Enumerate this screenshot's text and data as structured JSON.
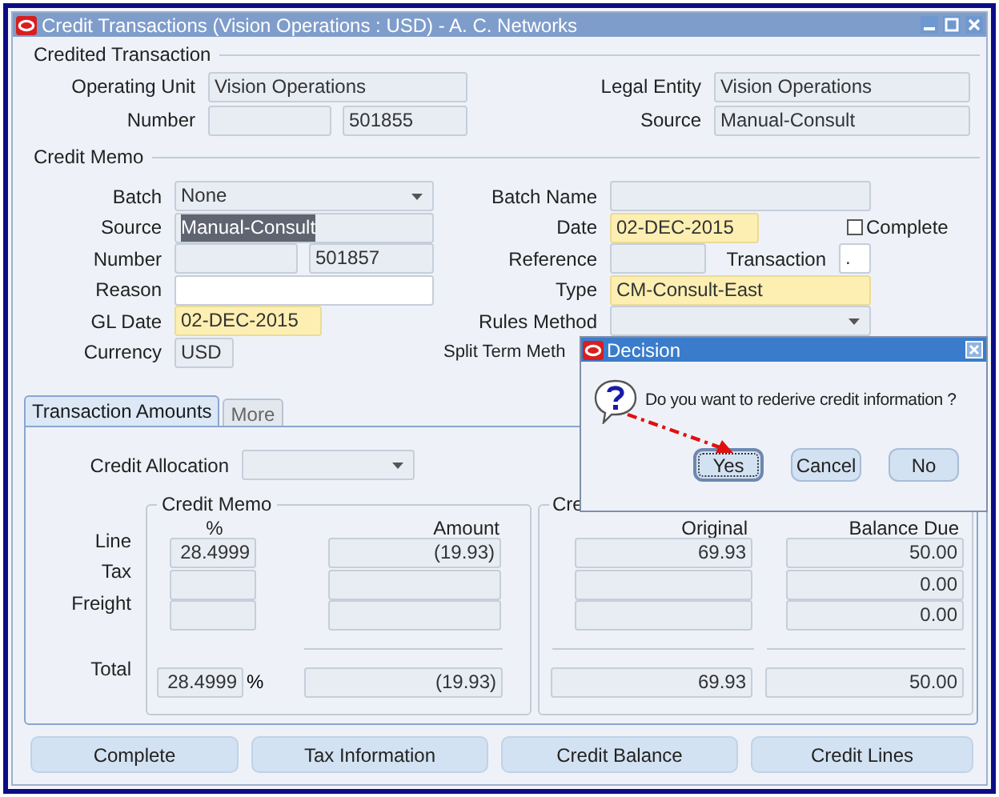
{
  "window": {
    "title": "Credit Transactions (Vision Operations : USD) - A. C. Networks"
  },
  "credited_transaction": {
    "title": "Credited Transaction",
    "left": [
      {
        "label": "Operating Unit",
        "value": "Vision Operations",
        "kind": "readonly"
      },
      {
        "label": "Number",
        "value": "501855",
        "kind": "split"
      }
    ],
    "right": [
      {
        "label": "Legal Entity",
        "value": "Vision Operations",
        "kind": "readonly"
      },
      {
        "label": "Source",
        "value": "Manual-Consult",
        "kind": "readonly"
      }
    ]
  },
  "credit_memo": {
    "title": "Credit Memo",
    "left": [
      {
        "label": "Batch",
        "value": "None",
        "kind": "dropdown"
      },
      {
        "label": "Source",
        "value": "Manual-Consult",
        "kind": "highlighted"
      },
      {
        "label": "Number",
        "value": "501857",
        "kind": "split"
      },
      {
        "label": "Reason",
        "kind": "editable"
      },
      {
        "label": "GL Date",
        "value": "02-DEC-2015",
        "kind": "required"
      },
      {
        "label": "Currency",
        "value": "USD",
        "kind": "readonly"
      }
    ],
    "right": [
      {
        "label": "Batch Name",
        "kind": "readonly"
      },
      {
        "label": "Date",
        "value": "02-DEC-2015",
        "kind": "required"
      },
      {
        "label": "Reference",
        "kind": "readonly"
      },
      {
        "label": "Type",
        "value": "CM-Consult-East",
        "kind": "required"
      },
      {
        "label": "Rules Method",
        "kind": "dropdown"
      },
      {
        "label": "Split Term Meth",
        "kind": "hidden"
      }
    ],
    "complete_checkbox": {
      "label": "Complete",
      "checked": false
    },
    "transaction_field": {
      "label": "Transaction",
      "value": ".",
      "kind": "editable"
    }
  },
  "tabs": [
    {
      "label": "Transaction Amounts",
      "selected": true
    },
    {
      "label": "More",
      "selected": false
    }
  ],
  "credit_allocation": {
    "label": "Credit Allocation",
    "kind": "dropdown"
  },
  "amounts": {
    "group_1": {
      "title": "Credit Memo",
      "columns": [
        "%",
        "Amount"
      ]
    },
    "group_2": {
      "title": "Cre",
      "columns": [
        "Original",
        "Balance Due"
      ]
    },
    "rows": [
      {
        "label": "Line",
        "percent": "28.4999",
        "amount": "(19.93)",
        "original": "69.93",
        "balance_due": "50.00"
      },
      {
        "label": "Tax",
        "balance_due": "0.00"
      },
      {
        "label": "Freight",
        "balance_due": "0.00"
      }
    ],
    "total": {
      "label": "Total",
      "percent": "28.4999",
      "unit": "%",
      "amount": "(19.93)",
      "original": "69.93",
      "balance_due": "50.00"
    }
  },
  "buttons": [
    "Complete",
    "Tax Information",
    "Credit Balance",
    "Credit Lines"
  ],
  "dialog": {
    "title": "Decision",
    "message": "Do you want to rederive credit information ?",
    "buttons": [
      {
        "label": "Yes",
        "focused": true
      },
      {
        "label": "Cancel",
        "focused": false
      },
      {
        "label": "No",
        "focused": false
      }
    ]
  }
}
